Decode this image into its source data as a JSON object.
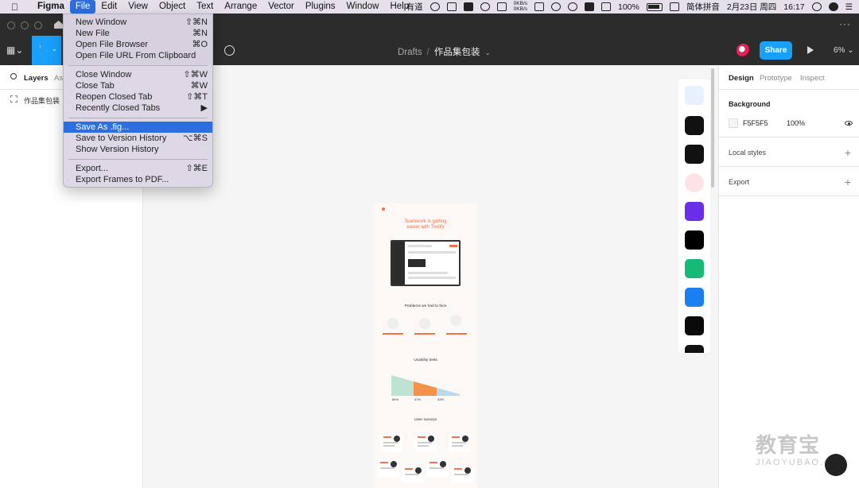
{
  "menubar": {
    "app": "Figma",
    "items": [
      "File",
      "Edit",
      "View",
      "Object",
      "Text",
      "Arrange",
      "Vector",
      "Plugins",
      "Window",
      "Help"
    ],
    "active": "File",
    "status": {
      "youdao": "有道",
      "net_up": "0KB/s",
      "net_down": "0KB/s",
      "battery": "100%",
      "input_method": "简体拼音",
      "date": "2月23日 周四",
      "time": "16:17"
    }
  },
  "toolbar": {
    "breadcrumb_root": "Drafts",
    "breadcrumb_sep": "/",
    "breadcrumb_file": "作品集包装",
    "share": "Share",
    "zoom": "6%"
  },
  "left_panel": {
    "tabs": [
      "Layers",
      "As"
    ],
    "layers": [
      "作品集包装"
    ]
  },
  "right_panel": {
    "tabs": [
      "Design",
      "Prototype",
      "Inspect"
    ],
    "background_title": "Background",
    "background_hex": "F5F5F5",
    "background_opacity": "100%",
    "local_styles": "Local styles",
    "export": "Export"
  },
  "file_menu": {
    "groups": [
      [
        {
          "label": "New Window",
          "shortcut": "⇧⌘N"
        },
        {
          "label": "New File",
          "shortcut": "⌘N"
        },
        {
          "label": "Open File Browser",
          "shortcut": "⌘O"
        },
        {
          "label": "Open File URL From Clipboard",
          "shortcut": ""
        }
      ],
      [
        {
          "label": "Close Window",
          "shortcut": "⇧⌘W"
        },
        {
          "label": "Close Tab",
          "shortcut": "⌘W"
        },
        {
          "label": "Reopen Closed Tab",
          "shortcut": "⇧⌘T"
        },
        {
          "label": "Recently Closed Tabs",
          "shortcut": "▶"
        }
      ],
      [
        {
          "label": "Save As .fig...",
          "shortcut": "",
          "highlighted": true
        },
        {
          "label": "Save to Version History",
          "shortcut": "⌥⌘S"
        },
        {
          "label": "Show Version History",
          "shortcut": ""
        }
      ],
      [
        {
          "label": "Export...",
          "shortcut": "⇧⌘E"
        },
        {
          "label": "Export Frames to PDF...",
          "shortcut": ""
        }
      ]
    ]
  },
  "frame": {
    "headline_1": "Teamwork is getting",
    "headline_2": "easier with Toolify",
    "section_problems": "Problems we had to face",
    "section_usability": "Usability tests",
    "section_surveys": "User surveys",
    "pct_1": "84%",
    "pct_2": "47%",
    "pct_3": "33%"
  },
  "watermark": {
    "text": "教育宝",
    "sub": "JIAOYUBAO.CN"
  },
  "colors": {
    "figma_blue": "#18a0fb",
    "macos_highlight": "#2d6fe0",
    "accent_orange": "#f4714b"
  }
}
